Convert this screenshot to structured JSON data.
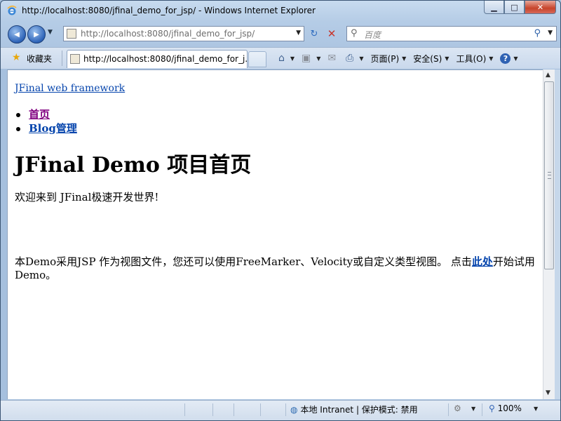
{
  "window": {
    "title": "http://localhost:8080/jfinal_demo_for_jsp/ - Windows Internet Explorer",
    "min_glyph": "▁",
    "max_glyph": "□",
    "close_glyph": "✕"
  },
  "navigation": {
    "back_glyph": "◀",
    "forward_glyph": "▶",
    "dropdown_glyph": "▼",
    "address_value": "http://localhost:8080/jfinal_demo_for_jsp/",
    "refresh_glyph": "↻",
    "stop_glyph": "✕",
    "search_placeholder": "百度",
    "search_glyph": "⚲"
  },
  "tabs_row": {
    "favorites_label": "收藏夹",
    "tab_label": "http://localhost:8080/jfinal_demo_for_j...",
    "commands": {
      "home_icon": "⌂",
      "feeds_icon": "▣",
      "mail_icon": "✉",
      "print_icon": "⎙",
      "page_label": "页面(P)",
      "safety_label": "安全(S)",
      "tools_label": "工具(O)",
      "help_icon": "?"
    }
  },
  "page": {
    "brand_link": "JFinal web framework",
    "nav_items": [
      "首页",
      "Blog管理"
    ],
    "heading": "JFinal Demo 项目首页",
    "welcome": "欢迎来到  JFinal极速开发世界!",
    "desc_before": "本Demo采用JSP 作为视图文件，您还可以使用FreeMarker、Velocity或自定义类型视图。  点击",
    "desc_link": "此处",
    "desc_after": "开始试用Demo。"
  },
  "status_bar": {
    "zone": "本地 Intranet | 保护模式: 禁用",
    "zoom": "100%"
  },
  "colors": {
    "link": "#0645ad",
    "visited_link": "#800080",
    "close_button": "#c7442b"
  }
}
